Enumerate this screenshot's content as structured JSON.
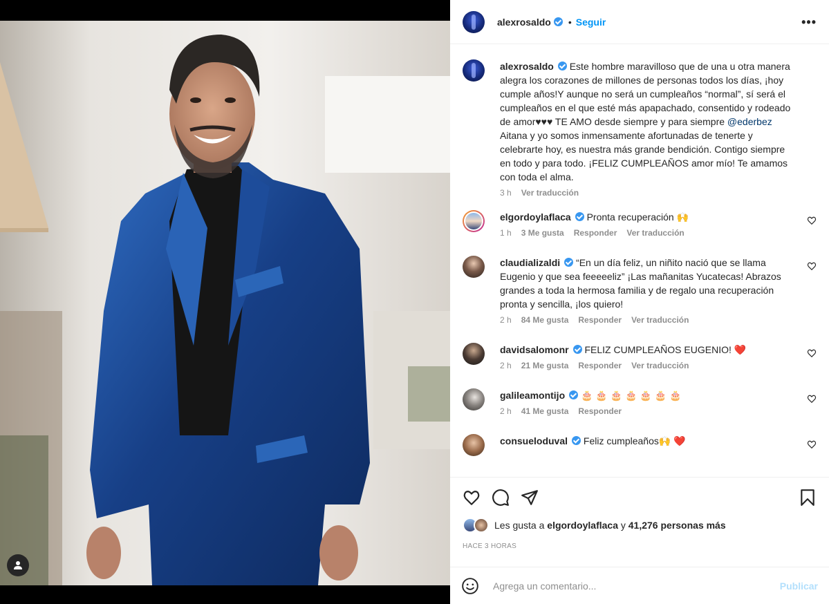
{
  "post": {
    "owner": "alexrosaldo",
    "follow_dot": "•",
    "follow_label": "Seguir",
    "more_label": "•••"
  },
  "caption": {
    "username": "alexrosaldo",
    "text_before": "Este hombre maravilloso que de una u otra manera alegra los corazones de millones de personas todos los días, ¡hoy cumple años!Y aunque no será un cumpleaños “normal”, sí será el cumpleaños en el que esté más apapachado, consentido y rodeado de amor♥♥♥ TE AMO desde siempre y para siempre ",
    "mention": "@ederbez",
    "text_after": " Aitana y yo somos inmensamente afortunadas de tenerte y celebrarte hoy, es nuestra más grande bendición. Contigo siempre en todo y para todo. ¡FELIZ CUMPLEAÑOS amor mío! Te amamos con toda el alma.",
    "time": "3 h",
    "translate": "Ver traducción"
  },
  "comments": [
    {
      "username": "elgordoylaflaca",
      "text": "Pronta recuperación 🙌",
      "time": "1 h",
      "likes": "3 Me gusta",
      "reply": "Responder",
      "translate": "Ver traducción"
    },
    {
      "username": "claudializaldi",
      "text": "“En un día feliz, un niñito nació que se llama Eugenio y que sea feeeeeliz” ¡Las mañanitas Yucatecas! Abrazos grandes a toda la hermosa familia y de regalo una recuperación pronta y sencilla, ¡los quiero!",
      "time": "2 h",
      "likes": "84 Me gusta",
      "reply": "Responder",
      "translate": "Ver traducción"
    },
    {
      "username": "davidsalomonr",
      "text": "FELIZ CUMPLEAÑOS EUGENIO! ❤️",
      "time": "2 h",
      "likes": "21 Me gusta",
      "reply": "Responder",
      "translate": "Ver traducción"
    },
    {
      "username": "galileamontijo",
      "text": "🎂 🎂 🎂 🎂 🎂 🎂 🎂",
      "time": "2 h",
      "likes": "41 Me gusta",
      "reply": "Responder"
    },
    {
      "username": "consueloduval",
      "text": "Feliz cumpleaños🙌  ❤️"
    }
  ],
  "likes": {
    "prefix": "Les gusta a",
    "user": "elgordoylaflaca",
    "conj": "y",
    "others": "41,276 personas más"
  },
  "timestamp": "HACE 3 HORAS",
  "add_comment": {
    "placeholder": "Agrega un comentario...",
    "publish": "Publicar"
  },
  "colors": {
    "accent": "#0095f6",
    "verified": "#3897f0",
    "suit": "#1f4f9e",
    "publish_disabled": "#b2dffc"
  }
}
